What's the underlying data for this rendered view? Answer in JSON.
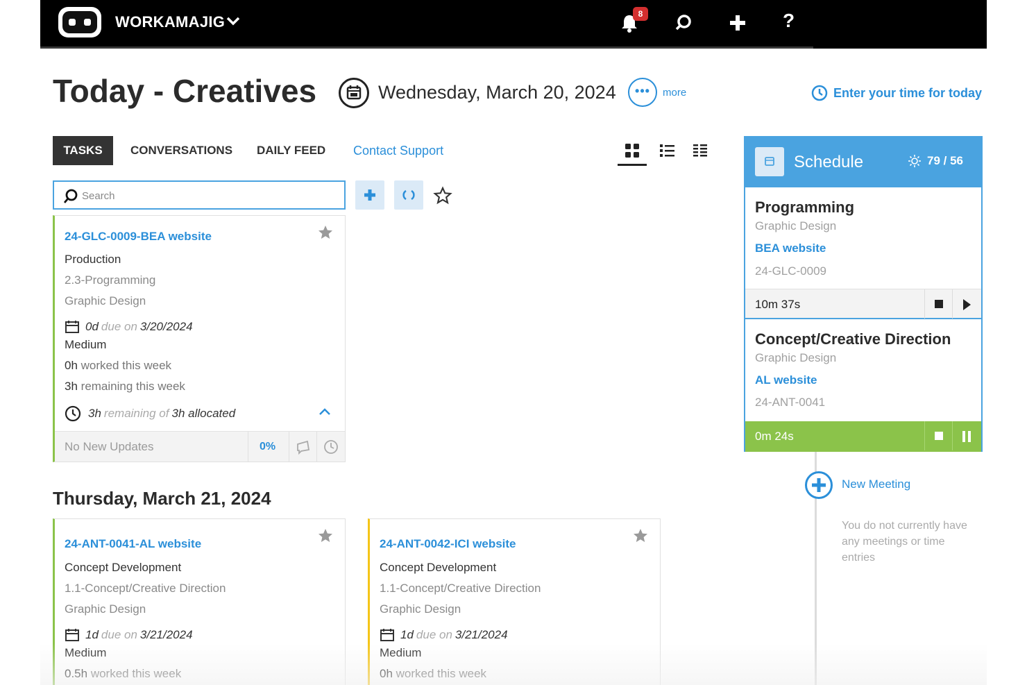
{
  "app": {
    "brand": "WORKAMAJIG",
    "notification_count": "8",
    "help_label": "?"
  },
  "header": {
    "title": "Today - Creatives",
    "date": "Wednesday, March 20, 2024",
    "more_label": "more",
    "enter_time_label": "Enter your time for today"
  },
  "tabs": [
    {
      "label": "TASKS",
      "active": true
    },
    {
      "label": "CONVERSATIONS",
      "active": false
    },
    {
      "label": "DAILY FEED",
      "active": false
    },
    {
      "label": "Contact Support",
      "active": false
    }
  ],
  "search": {
    "placeholder": "Search",
    "value": ""
  },
  "today_tasks": [
    {
      "title": "24-GLC-0009-BEA website",
      "phase": "Production",
      "task": "2.3-Programming",
      "department": "Graphic Design",
      "due_days": "0d",
      "due_label": "due on",
      "due_date": "3/20/2024",
      "priority": "Medium",
      "worked_value": "0h",
      "worked_label": "worked this week",
      "remaining_value": "3h",
      "remaining_label": "remaining this week",
      "alloc_remaining": "3h",
      "alloc_mid": "remaining of",
      "alloc_total": "3h allocated",
      "updates": "No New Updates",
      "percent": "0%",
      "accent": "#8bc34a"
    }
  ],
  "next_section": {
    "date": "Thursday, March 21, 2024"
  },
  "next_tasks": [
    {
      "title": "24-ANT-0041-AL website",
      "phase": "Concept Development",
      "task": "1.1-Concept/Creative Direction",
      "department": "Graphic Design",
      "due_days": "1d",
      "due_label": "due on",
      "due_date": "3/21/2024",
      "priority": "Medium",
      "worked_value": "0.5h",
      "worked_label": "worked this week",
      "accent": "#8bc34a"
    },
    {
      "title": "24-ANT-0042-ICI website",
      "phase": "Concept Development",
      "task": "1.1-Concept/Creative Direction",
      "department": "Graphic Design",
      "due_days": "1d",
      "due_label": "due on",
      "due_date": "3/21/2024",
      "priority": "Medium",
      "worked_value": "0h",
      "worked_label": "worked this week",
      "accent": "#f5c518"
    }
  ],
  "schedule": {
    "title": "Schedule",
    "count": "79 / 56",
    "entries": [
      {
        "title": "Programming",
        "department": "Graphic Design",
        "project": "BEA website",
        "code": "24-GLC-0009",
        "timer": "10m 37s",
        "state": "stopped"
      },
      {
        "title": "Concept/Creative Direction",
        "department": "Graphic Design",
        "project": "AL website",
        "code": "24-ANT-0041",
        "timer": "0m 24s",
        "state": "running"
      }
    ],
    "new_meeting_label": "New Meeting",
    "empty_message": "You do not currently have any meetings or time entries"
  },
  "colors": {
    "accent_blue": "#2b8fd9",
    "panel_blue": "#4aa3e0",
    "running_green": "#8bc34a",
    "badge_red": "#d32f2f"
  }
}
